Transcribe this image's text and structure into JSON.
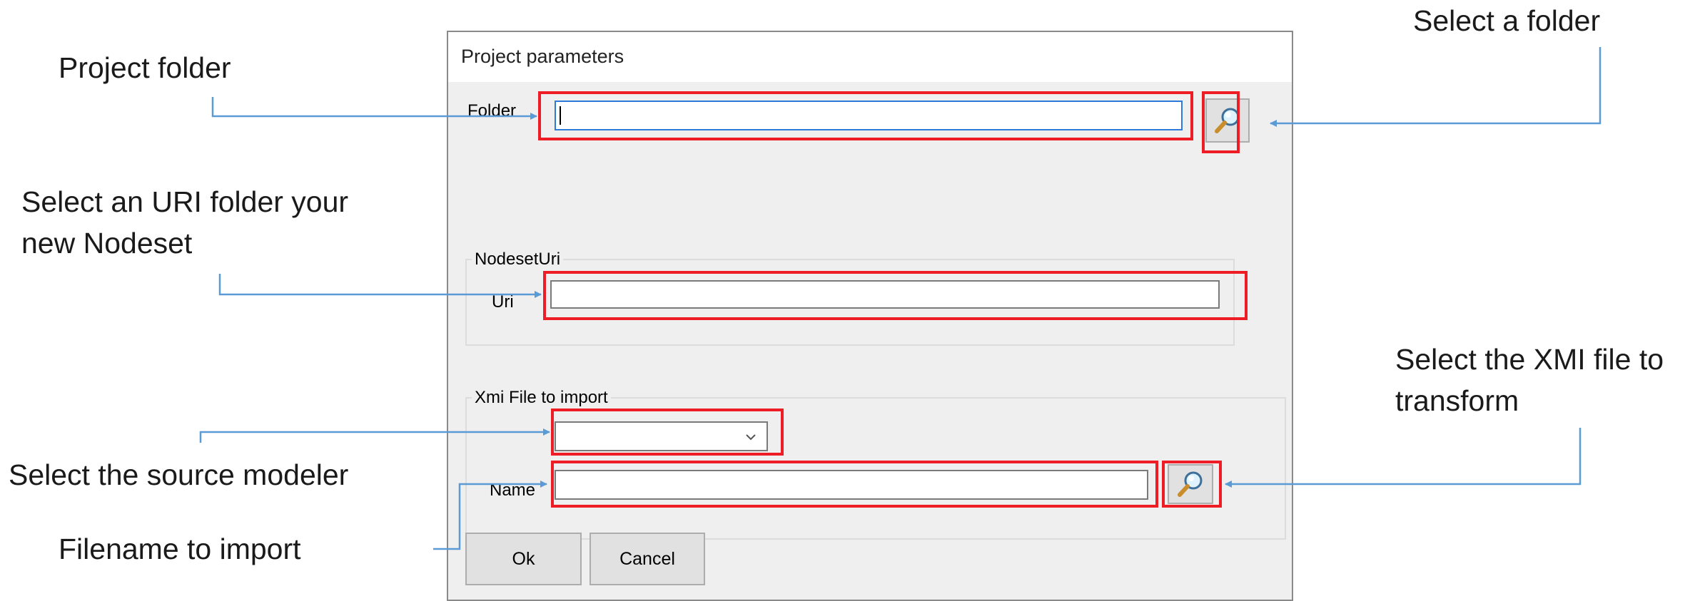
{
  "dialog": {
    "title": "Project parameters",
    "folder": {
      "label": "Folder",
      "value": ""
    },
    "nodeset_group": {
      "title": "NodesetUri",
      "uri_label": "Uri",
      "uri_value": ""
    },
    "xmi_group": {
      "title": "Xmi File to import",
      "modeler_selected": "",
      "name_label": "Name",
      "name_value": ""
    },
    "buttons": {
      "ok": "Ok",
      "cancel": "Cancel"
    },
    "icons": {
      "browse": "magnifier-icon",
      "dropdown": "chevron-down-icon"
    }
  },
  "annotations": {
    "project_folder": "Project folder",
    "select_folder": "Select a folder",
    "uri_line1": "Select an URI folder your",
    "uri_line2": "new Nodeset",
    "xmi_line1": "Select the XMI file to",
    "xmi_line2": "transform",
    "source_modeler": "Select the source modeler",
    "filename": "Filename to import"
  },
  "colors": {
    "highlight": "#ee1c25",
    "arrow": "#5b9bd5",
    "dialog_bg": "#efefef"
  }
}
